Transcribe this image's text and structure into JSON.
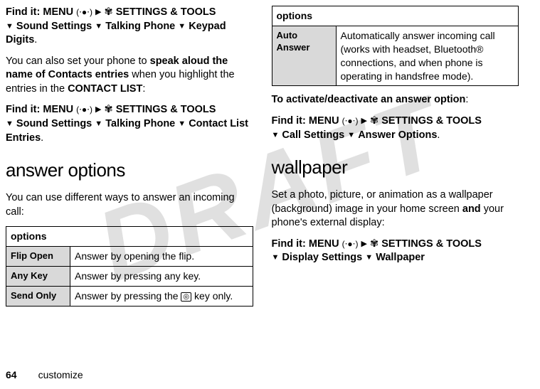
{
  "footer": {
    "page": "64",
    "section": "customize"
  },
  "watermark": "DRAFT",
  "icons": {
    "center": "(⋅●⋅)",
    "arrow": "▶",
    "tools": "✾",
    "down": "▼"
  },
  "left": {
    "find1": {
      "label": "Find it:",
      "menu": "MENU",
      "tools": "SETTINGS & TOOLS",
      "path1": "Sound Settings",
      "path2": "Talking Phone",
      "path3": "Keypad Digits"
    },
    "para1a": "You can also set your phone to ",
    "para1b": "speak aloud the name of Contacts entries",
    "para1c": " when you highlight the entries in the ",
    "para1d": "CONTACT LIST",
    "find2": {
      "label": "Find it:",
      "menu": "MENU",
      "tools": "SETTINGS & TOOLS",
      "path1": "Sound Settings",
      "path2": "Talking Phone",
      "path3": "Contact List Entries"
    },
    "heading": "answer options",
    "intro": "You can use different ways to answer an incoming call:",
    "table": {
      "header": "options",
      "rows": [
        {
          "name": "Flip Open",
          "desc": "Answer by opening the flip."
        },
        {
          "name": "Any Key",
          "desc": "Answer by pressing any key."
        },
        {
          "name": "Send Only",
          "descA": "Answer by pressing the ",
          "key": "◎",
          "descB": " key only."
        }
      ]
    }
  },
  "right": {
    "table": {
      "header": "options",
      "rows": [
        {
          "name": "Auto Answer",
          "desc": "Automatically answer incoming call (works with headset, Bluetooth® connections, and when phone is operating in handsfree mode)."
        }
      ]
    },
    "activate": "To activate/deactivate an answer option",
    "find3": {
      "label": "Find it:",
      "menu": "MENU",
      "tools": "SETTINGS & TOOLS",
      "path1": "Call Settings",
      "path2": "Answer Options"
    },
    "heading": "wallpaper",
    "wp_a": "Set a photo, picture, or animation as a wallpaper (background) image in your home screen ",
    "wp_b": "and",
    "wp_c": " your phone's external display:",
    "find4": {
      "label": "Find it:",
      "menu": "MENU",
      "tools": "SETTINGS & TOOLS",
      "path1": "Display Settings",
      "path2": "Wallpaper"
    }
  }
}
